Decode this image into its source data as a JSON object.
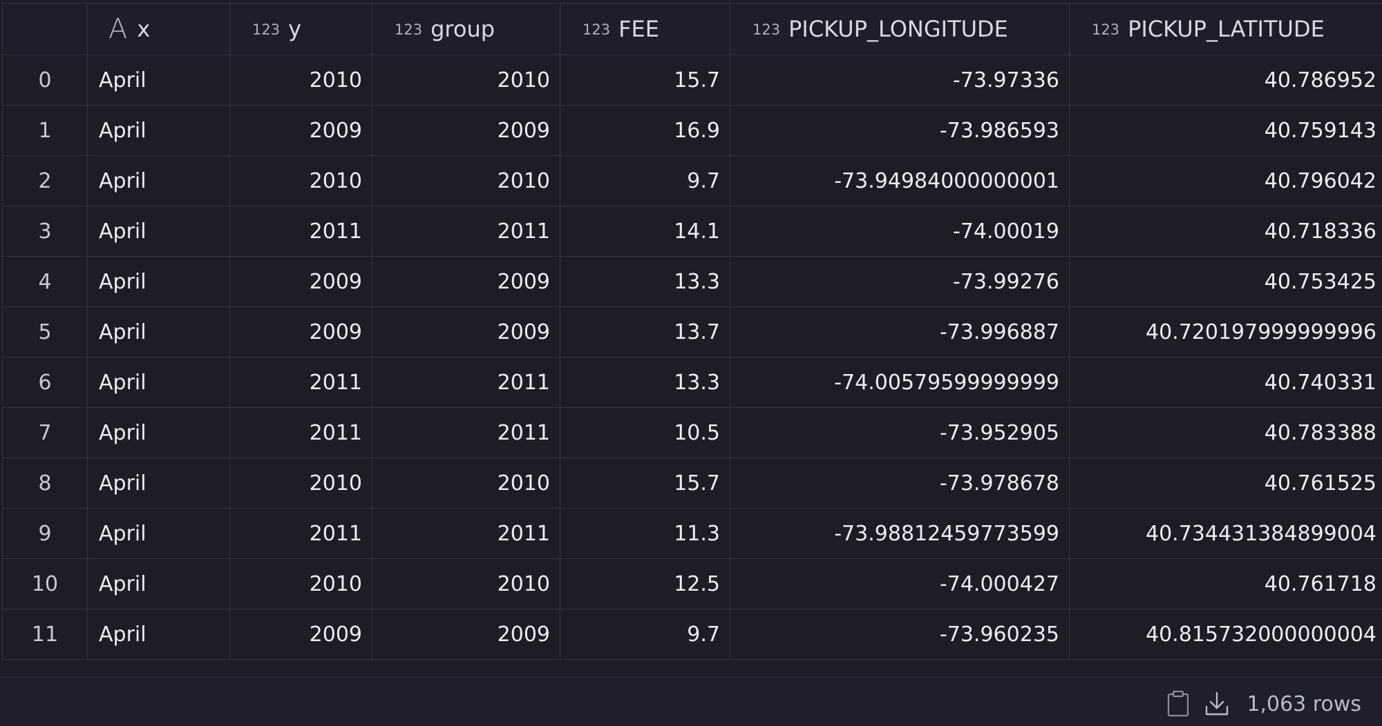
{
  "table": {
    "columns": [
      {
        "type": "",
        "name": ""
      },
      {
        "type": "A",
        "name": "x"
      },
      {
        "type": "123",
        "name": "y"
      },
      {
        "type": "123",
        "name": "group"
      },
      {
        "type": "123",
        "name": "FEE"
      },
      {
        "type": "123",
        "name": "PICKUP_LONGITUDE"
      },
      {
        "type": "123",
        "name": "PICKUP_LATITUDE"
      }
    ],
    "rows": [
      [
        "0",
        "April",
        "2010",
        "2010",
        "15.7",
        "-73.97336",
        "40.786952"
      ],
      [
        "1",
        "April",
        "2009",
        "2009",
        "16.9",
        "-73.986593",
        "40.759143"
      ],
      [
        "2",
        "April",
        "2010",
        "2010",
        "9.7",
        "-73.94984000000001",
        "40.796042"
      ],
      [
        "3",
        "April",
        "2011",
        "2011",
        "14.1",
        "-74.00019",
        "40.718336"
      ],
      [
        "4",
        "April",
        "2009",
        "2009",
        "13.3",
        "-73.99276",
        "40.753425"
      ],
      [
        "5",
        "April",
        "2009",
        "2009",
        "13.7",
        "-73.996887",
        "40.720197999999996"
      ],
      [
        "6",
        "April",
        "2011",
        "2011",
        "13.3",
        "-74.00579599999999",
        "40.740331"
      ],
      [
        "7",
        "April",
        "2011",
        "2011",
        "10.5",
        "-73.952905",
        "40.783388"
      ],
      [
        "8",
        "April",
        "2010",
        "2010",
        "15.7",
        "-73.978678",
        "40.761525"
      ],
      [
        "9",
        "April",
        "2011",
        "2011",
        "11.3",
        "-73.98812459773599",
        "40.734431384899004"
      ],
      [
        "10",
        "April",
        "2010",
        "2010",
        "12.5",
        "-74.000427",
        "40.761718"
      ],
      [
        "11",
        "April",
        "2009",
        "2009",
        "9.7",
        "-73.960235",
        "40.815732000000004"
      ]
    ]
  },
  "footer": {
    "icons": [
      "clipboard-icon",
      "download-icon"
    ],
    "row_count": "1,063 rows"
  }
}
